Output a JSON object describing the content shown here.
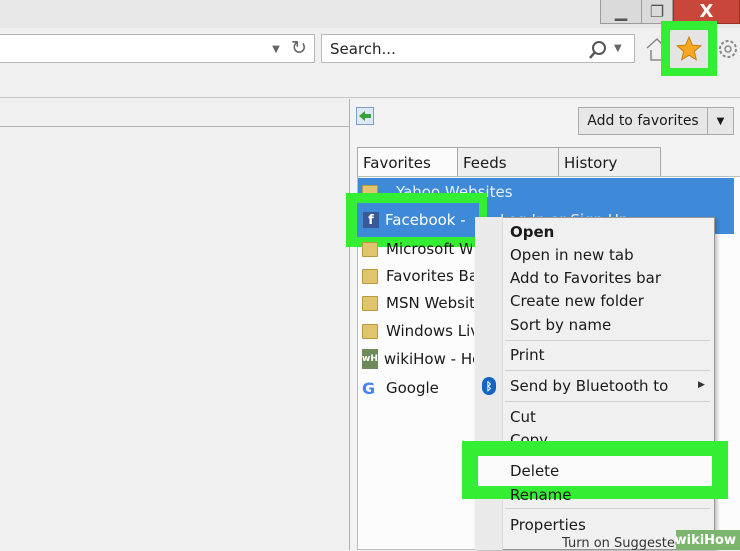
{
  "window": {
    "minimize_glyph": "▁",
    "restore_glyph": "❐",
    "close_glyph": "X"
  },
  "toolbar": {
    "search_placeholder": "Search...",
    "icons": [
      "dropdown-icon",
      "refresh-icon",
      "search-icon",
      "home-icon",
      "favorites-star-icon",
      "gear-icon"
    ]
  },
  "favorites_panel": {
    "add_button": "Add to favorites",
    "tabs": [
      "Favorites",
      "Feeds",
      "History"
    ],
    "items": [
      {
        "label": "Yahoo Websites",
        "kind": "folder"
      },
      {
        "label": "Facebook -",
        "kind": "facebook",
        "trailing": "Log In or Sign Up"
      },
      {
        "label": "Microsoft W",
        "kind": "folder"
      },
      {
        "label": "Favorites Bar",
        "kind": "folder"
      },
      {
        "label": "MSN Websit",
        "kind": "folder"
      },
      {
        "label": "Windows Liv",
        "kind": "folder"
      },
      {
        "label": "wikiHow - Ho",
        "kind": "wikihow"
      },
      {
        "label": "Google",
        "kind": "google"
      }
    ],
    "footer": "Turn on Suggested Sites..."
  },
  "context_menu": {
    "items": [
      {
        "label": "Open",
        "bold": true
      },
      {
        "label": "Open in new tab"
      },
      {
        "label": "Add to Favorites bar"
      },
      {
        "label": "Create new folder"
      },
      {
        "label": "Sort by name"
      },
      {
        "label": "Print"
      },
      {
        "label": "Send by Bluetooth to"
      },
      {
        "label": "Cut"
      },
      {
        "label": "Copy"
      },
      {
        "label": "Delete"
      },
      {
        "label": "Rename"
      },
      {
        "label": "Properties"
      }
    ]
  },
  "watermark": "wikiHow",
  "colors": {
    "highlight": "#33ee33",
    "selection": "#3f8ad8",
    "star": "#f5a623"
  }
}
